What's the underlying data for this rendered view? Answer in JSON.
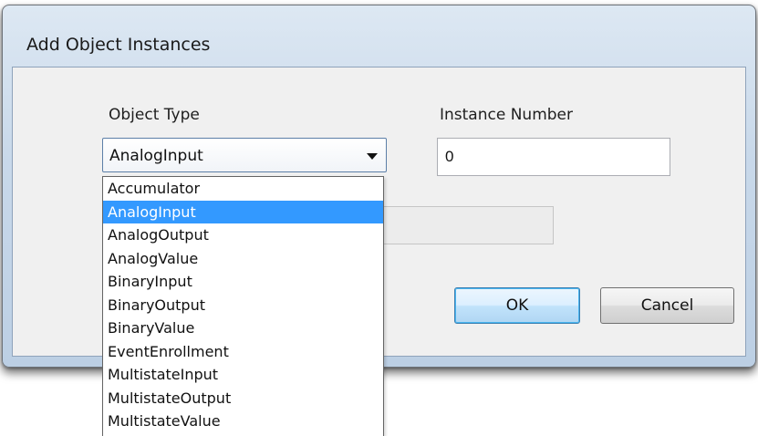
{
  "dialog": {
    "title": "Add Object Instances"
  },
  "object_type": {
    "label": "Object Type",
    "selected": "AnalogInput",
    "options": [
      "Accumulator",
      "AnalogInput",
      "AnalogOutput",
      "AnalogValue",
      "BinaryInput",
      "BinaryOutput",
      "BinaryValue",
      "EventEnrollment",
      "MultistateInput",
      "MultistateOutput",
      "MultistateValue"
    ],
    "highlighted_index": 1
  },
  "instance_number": {
    "label": "Instance Number",
    "value": "0"
  },
  "buttons": {
    "ok": "OK",
    "cancel": "Cancel"
  },
  "colors": {
    "selection": "#3399ff",
    "window_frame": "#c9d9ea"
  }
}
